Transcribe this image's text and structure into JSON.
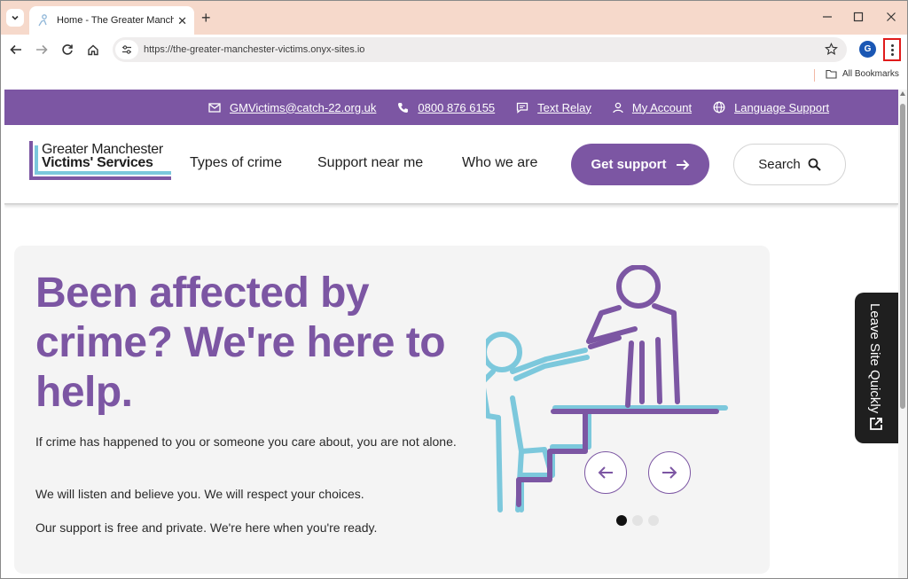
{
  "browser": {
    "tab_title": "Home - The Greater Manchester Victims' Services",
    "url": "https://the-greater-manchester-victims.onyx-sites.io",
    "profile_initial": "G",
    "all_bookmarks_label": "All Bookmarks"
  },
  "topbar": {
    "email": "GMVictims@catch-22.org.uk",
    "phone": "0800 876 6155",
    "text_relay": "Text Relay",
    "my_account": "My Account",
    "language_support": "Language Support"
  },
  "header": {
    "logo_line1": "Greater Manchester",
    "logo_line2": "Victims' Services",
    "nav": [
      "Types of crime",
      "Support near me",
      "Who we are"
    ],
    "get_support": "Get support",
    "search": "Search"
  },
  "hero": {
    "heading": "Been affected by crime? We're here to help.",
    "paragraphs": [
      "If crime has happened to you or someone you care about, you are not alone.",
      "We will listen and believe you. We will respect your choices.",
      "Our support is free and private. We're here when you're ready."
    ],
    "carousel": {
      "slide_count": 3,
      "active_index": 0
    }
  },
  "leave_site": {
    "label": "Leave Site Quickly"
  },
  "colors": {
    "brand_purple": "#7c56a3",
    "brand_blue": "#7cc8dc",
    "tab_strip": "#f6d9cb",
    "menu_highlight": "#e01b1b"
  }
}
